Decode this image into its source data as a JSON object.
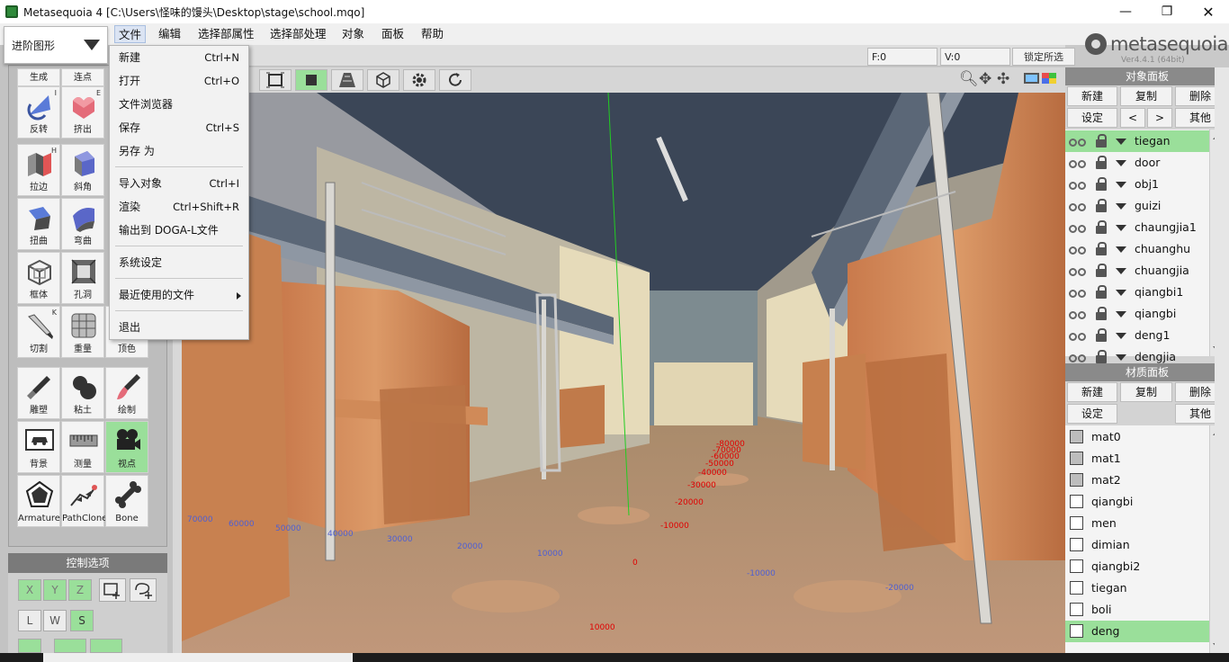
{
  "window": {
    "title": "Metasequoia 4 [C:\\Users\\怪味的馒头\\Desktop\\stage\\school.mqo]",
    "minimize": "—",
    "maximize": "❐",
    "close": "✕"
  },
  "mode_select": {
    "value": "进阶图形"
  },
  "menubar": {
    "items": [
      "文件",
      "编辑",
      "选择部属性",
      "选择部处理",
      "对象",
      "面板",
      "帮助"
    ]
  },
  "file_menu": {
    "items": [
      {
        "label": "新建",
        "shortcut": "Ctrl+N"
      },
      {
        "label": "打开",
        "shortcut": "Ctrl+O"
      },
      {
        "label": "文件浏览器",
        "shortcut": ""
      },
      {
        "label": "保存",
        "shortcut": "Ctrl+S"
      },
      {
        "label": "另存 为",
        "shortcut": ""
      },
      {
        "label": "导入对象",
        "shortcut": "Ctrl+I"
      },
      {
        "label": "渲染",
        "shortcut": "Ctrl+Shift+R"
      },
      {
        "label": "输出到 DOGA-L文件",
        "shortcut": ""
      },
      {
        "label": "系统设定",
        "shortcut": ""
      },
      {
        "label": "最近使用的文件",
        "shortcut": ""
      },
      {
        "label": "退出",
        "shortcut": ""
      }
    ]
  },
  "status": {
    "f": "F:0",
    "v": "V:0",
    "lock_selection": "锁定所选"
  },
  "logo": {
    "text": "metasequoia",
    "num": "4",
    "version": "Ver4.4.1 (64bit)"
  },
  "tools": [
    {
      "label": "生成",
      "key": ""
    },
    {
      "label": "连点",
      "key": ""
    },
    {
      "label": "反转",
      "key": "I"
    },
    {
      "label": "挤出",
      "key": "E"
    },
    {
      "label": "拉边",
      "key": "H"
    },
    {
      "label": "斜角",
      "key": ""
    },
    {
      "label": "扭曲",
      "key": ""
    },
    {
      "label": "弯曲",
      "key": ""
    },
    {
      "label": "框体",
      "key": ""
    },
    {
      "label": "孔洞",
      "key": ""
    },
    {
      "label": "切割",
      "key": "K"
    },
    {
      "label": "重量",
      "key": ""
    },
    {
      "label": "顶色",
      "key": ""
    },
    {
      "label": "雕塑",
      "key": ""
    },
    {
      "label": "粘土",
      "key": ""
    },
    {
      "label": "绘制",
      "key": ""
    },
    {
      "label": "背景",
      "key": ""
    },
    {
      "label": "测量",
      "key": ""
    },
    {
      "label": "视点",
      "key": ""
    },
    {
      "label": "Armature",
      "key": ""
    },
    {
      "label": "PathClone",
      "key": ""
    },
    {
      "label": "Bone",
      "key": ""
    }
  ],
  "control": {
    "title": "控制选项",
    "axes": [
      "X",
      "Y",
      "Z"
    ],
    "lws": [
      "L",
      "W",
      "S"
    ]
  },
  "object_panel": {
    "title": "对象面板",
    "buttons": [
      "新建",
      "复制",
      "删除",
      "设定",
      "<",
      ">",
      "其他"
    ],
    "objects": [
      "tiegan",
      "door",
      "obj1",
      "guizi",
      "chaungjia1",
      "chuanghu",
      "chuangjia",
      "qiangbi1",
      "qiangbi",
      "deng1",
      "dengjia"
    ],
    "selected": "tiegan"
  },
  "material_panel": {
    "title": "材质面板",
    "buttons": [
      "新建",
      "复制",
      "删除",
      "设定",
      "其他"
    ],
    "materials": [
      "mat0",
      "mat1",
      "mat2",
      "qiangbi",
      "men",
      "dimian",
      "qiangbi2",
      "tiegan",
      "boli",
      "deng"
    ],
    "selected": "deng"
  },
  "axis_labels": {
    "red": [
      "-80000",
      "-70000",
      "-60000",
      "-50000",
      "-40000",
      "-30000",
      "-20000",
      "-10000",
      "0",
      "10000"
    ],
    "blue": [
      "70000",
      "60000",
      "50000",
      "40000",
      "30000",
      "20000",
      "10000",
      "-10000",
      "-20000"
    ]
  },
  "colors": {
    "accent_green": "#9adf9a",
    "sky": "#3b4657",
    "wood": "#c98354",
    "floor": "#b89070"
  }
}
